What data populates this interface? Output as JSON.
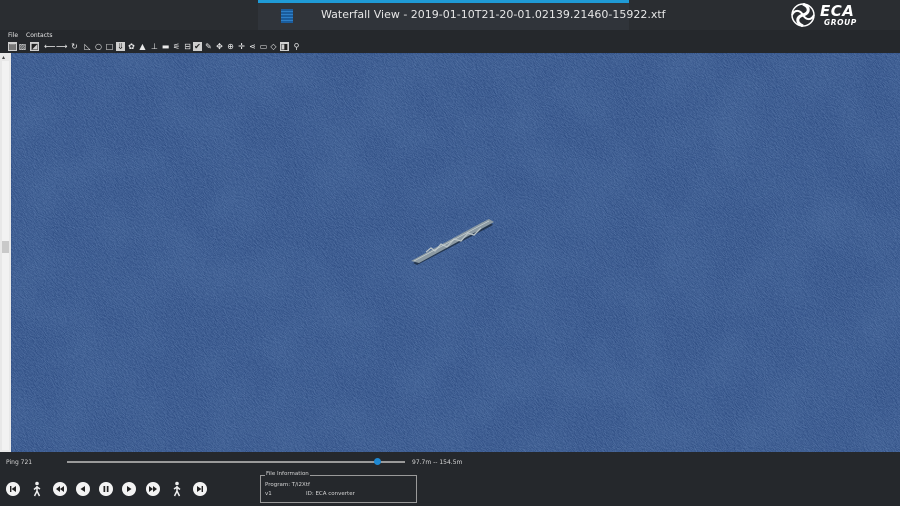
{
  "window": {
    "title": "Waterfall View - 2019-01-10T21-20-01.02139.21460-15922.xtf",
    "tab_icon": "sonar-waterfall-icon"
  },
  "logo": {
    "brand": "ECA",
    "subtitle": "GROUP"
  },
  "menu": {
    "items": [
      "File",
      "Contacts"
    ]
  },
  "toolbar": {
    "icons": [
      "open-file-icon",
      "save-icon",
      "layers-icon",
      "arrow-left-icon",
      "arrow-right-icon",
      "rotate-icon",
      "angle-measure-icon",
      "circle-tool-icon",
      "rectangle-tool-icon",
      "download-icon",
      "palette-icon",
      "bucket-icon",
      "baseline-icon",
      "altitude-icon",
      "image-icon",
      "person-measure-icon",
      "checkbox-icon",
      "edit-icon",
      "move-icon",
      "globe-icon",
      "crosshair-icon",
      "share-icon",
      "window-icon",
      "diamond-icon",
      "bookmark-icon",
      "frame-icon",
      "wrench-icon"
    ]
  },
  "status": {
    "ping_label": "Ping 721",
    "range_label": "97.7m -- 154.5m",
    "slider_value": 0.92
  },
  "playback": {
    "icons": [
      "skip-to-start-icon",
      "walker-left-icon",
      "fast-rewind-icon",
      "play-reverse-icon",
      "pause-icon",
      "play-icon",
      "fast-forward-icon",
      "walker-right-icon",
      "skip-to-end-icon"
    ]
  },
  "file_info": {
    "legend": "File Information",
    "program_label": "Program: T/i2Xtf",
    "version_label": "v1",
    "id_label": "ID: ECA converter"
  },
  "colors": {
    "accent": "#1f9bd7",
    "seabed": "#2c4a7e",
    "background": "#25282c"
  }
}
